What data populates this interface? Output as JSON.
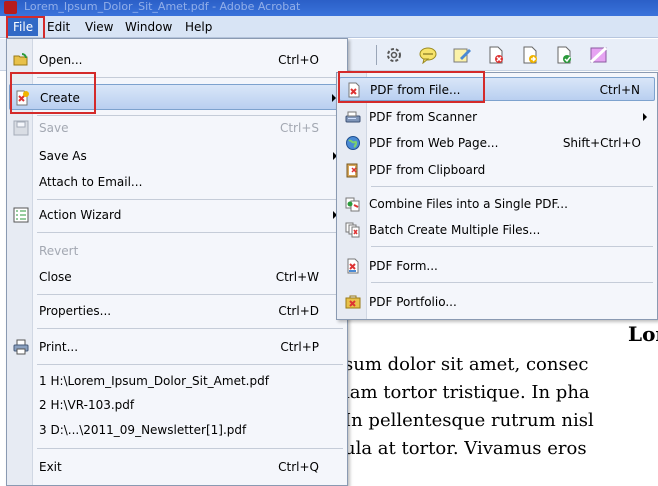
{
  "window": {
    "title": "Lorem_Ipsum_Dolor_Sit_Amet.pdf - Adobe Acrobat"
  },
  "menubar": [
    "File",
    "Edit",
    "View",
    "Window",
    "Help"
  ],
  "file_menu": {
    "items": [
      {
        "label": "Open...",
        "shortcut": "Ctrl+O"
      },
      {
        "label": "Create",
        "shortcut": ""
      },
      {
        "label": "Save",
        "shortcut": "Ctrl+S"
      },
      {
        "label": "Save As",
        "shortcut": ""
      },
      {
        "label": "Attach to Email...",
        "shortcut": ""
      },
      {
        "label": "Action Wizard",
        "shortcut": ""
      },
      {
        "label": "Revert",
        "shortcut": ""
      },
      {
        "label": "Close",
        "shortcut": "Ctrl+W"
      },
      {
        "label": "Properties...",
        "shortcut": "Ctrl+D"
      },
      {
        "label": "Print...",
        "shortcut": "Ctrl+P"
      },
      {
        "label": "1 H:\\Lorem_Ipsum_Dolor_Sit_Amet.pdf",
        "shortcut": ""
      },
      {
        "label": "2 H:\\VR-103.pdf",
        "shortcut": ""
      },
      {
        "label": "3 D:\\...\\2011_09_Newsletter[1].pdf",
        "shortcut": ""
      },
      {
        "label": "Exit",
        "shortcut": "Ctrl+Q"
      }
    ]
  },
  "create_submenu": {
    "items": [
      {
        "label": "PDF from File...",
        "shortcut": "Ctrl+N"
      },
      {
        "label": "PDF from Scanner",
        "shortcut": ""
      },
      {
        "label": "PDF from Web Page...",
        "shortcut": "Shift+Ctrl+O"
      },
      {
        "label": "PDF from Clipboard",
        "shortcut": ""
      },
      {
        "label": "Combine Files into a Single PDF...",
        "shortcut": ""
      },
      {
        "label": "Batch Create Multiple Files...",
        "shortcut": ""
      },
      {
        "label": "PDF Form...",
        "shortcut": ""
      },
      {
        "label": "PDF Portfolio...",
        "shortcut": ""
      }
    ]
  },
  "document": {
    "heading": "Lor",
    "lines": [
      "sum dolor sit amet, consec",
      "iam tortor tristique. In pha",
      "In pellentesque rutrum nisl",
      "ula at tortor. Vivamus eros"
    ]
  },
  "colors": {
    "highlight_box": "#d42a2a",
    "menubar_bg": "#d8e4f5",
    "active_menu": "#3169c6"
  }
}
